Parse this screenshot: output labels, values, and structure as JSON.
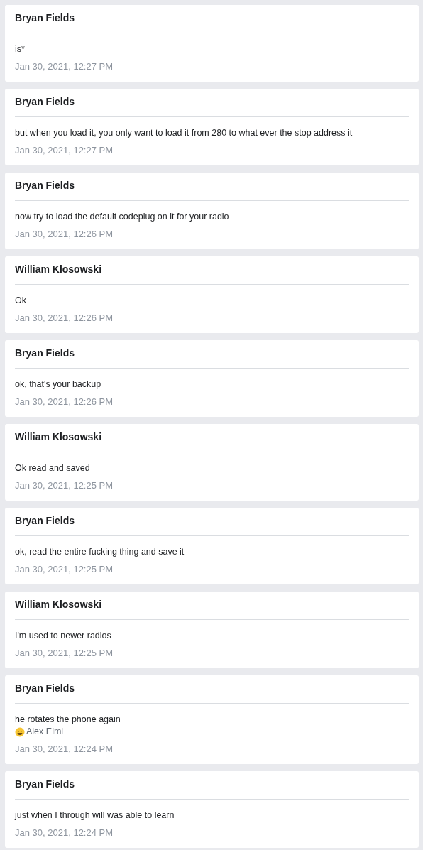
{
  "messages": [
    {
      "author": "Bryan Fields",
      "text": "is*",
      "time": "Jan 30, 2021, 12:27 PM"
    },
    {
      "author": "Bryan Fields",
      "text": "but when you load it, you only want to load it from 280 to what ever the stop address it",
      "time": "Jan 30, 2021, 12:27 PM"
    },
    {
      "author": "Bryan Fields",
      "text": "now try to load the default codeplug on it for your radio",
      "time": "Jan 30, 2021, 12:26 PM"
    },
    {
      "author": "William Klosowski",
      "text": "Ok",
      "time": "Jan 30, 2021, 12:26 PM"
    },
    {
      "author": "Bryan Fields",
      "text": "ok, that's your backup",
      "time": "Jan 30, 2021, 12:26 PM"
    },
    {
      "author": "William Klosowski",
      "text": "Ok read and saved",
      "time": "Jan 30, 2021, 12:25 PM"
    },
    {
      "author": "Bryan Fields",
      "text": "ok, read the entire fucking thing and save it",
      "time": "Jan 30, 2021, 12:25 PM"
    },
    {
      "author": "William Klosowski",
      "text": "I'm used to newer radios",
      "time": "Jan 30, 2021, 12:25 PM"
    },
    {
      "author": "Bryan Fields",
      "text": "he rotates the phone again",
      "reaction": {
        "name": "Alex Elmi"
      },
      "time": "Jan 30, 2021, 12:24 PM"
    },
    {
      "author": "Bryan Fields",
      "text": "just when I through will was able to learn",
      "time": "Jan 30, 2021, 12:24 PM"
    }
  ]
}
